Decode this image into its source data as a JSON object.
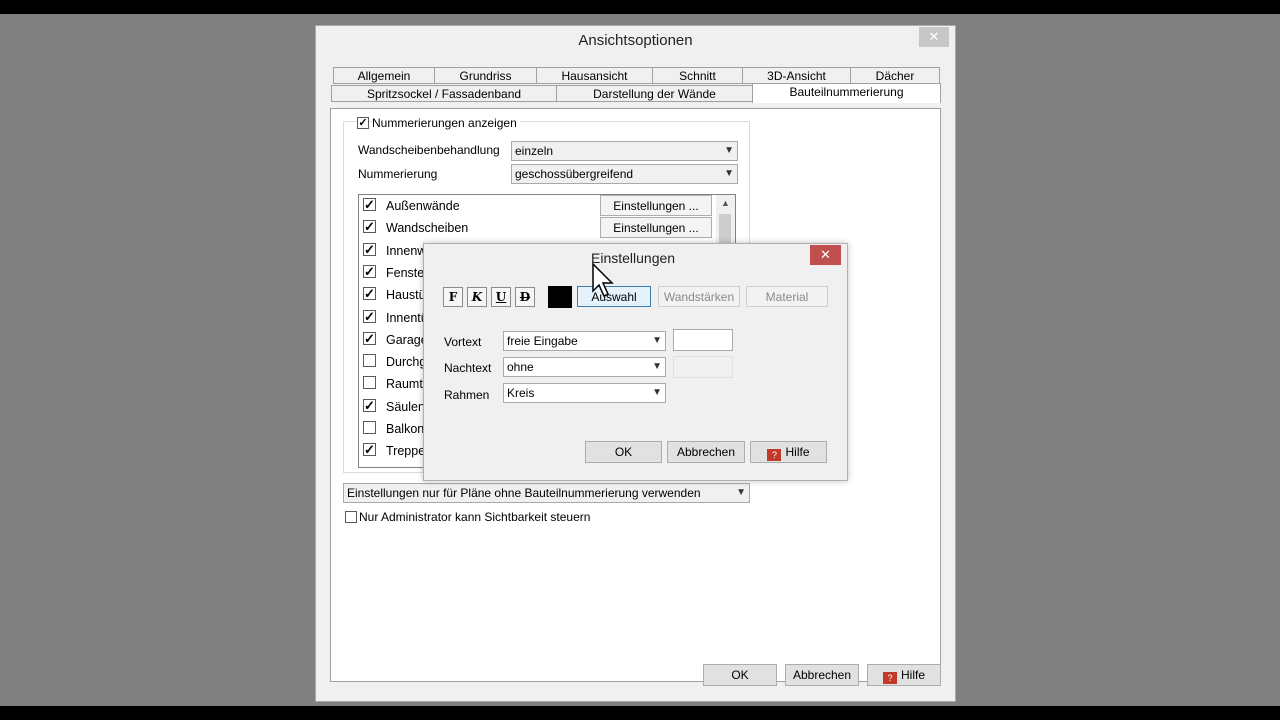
{
  "main_window": {
    "title": "Ansichtsoptionen",
    "close_glyph": "✕",
    "tabs_row1": [
      "Allgemein",
      "Grundriss",
      "Hausansicht",
      "Schnitt",
      "3D-Ansicht",
      "Dächer"
    ],
    "tabs_row2": [
      "Spritzsockel / Fassadenband",
      "Darstellung der Wände",
      "Bauteilnummerierung"
    ],
    "show_numbering": {
      "label": "Nummerierungen anzeigen",
      "checked": true
    },
    "wall_handling": {
      "label": "Wandscheibenbehandlung",
      "value": "einzeln"
    },
    "numbering": {
      "label": "Nummerierung",
      "value": "geschossübergreifend"
    },
    "items": [
      {
        "label": "Außenwände",
        "checked": true,
        "button": "Einstellungen ..."
      },
      {
        "label": "Wandscheiben",
        "checked": true,
        "button": "Einstellungen ..."
      },
      {
        "label": "Innenw",
        "checked": true
      },
      {
        "label": "Fenster",
        "checked": true
      },
      {
        "label": "Haustü",
        "checked": true
      },
      {
        "label": "Innentü",
        "checked": true
      },
      {
        "label": "Garage",
        "checked": true
      },
      {
        "label": "Durchg",
        "checked": false
      },
      {
        "label": "Raumt",
        "checked": false
      },
      {
        "label": "Säulen",
        "checked": true
      },
      {
        "label": "Balkon",
        "checked": false
      },
      {
        "label": "Treppe",
        "checked": true
      }
    ],
    "plans_dropdown": "Einstellungen nur für Pläne ohne Bauteilnummerierung verwenden",
    "admin_only": {
      "label": "Nur Administrator kann Sichtbarkeit steuern",
      "checked": false
    },
    "buttons": {
      "ok": "OK",
      "cancel": "Abbrechen",
      "help": "Hilfe"
    },
    "help_icon_text": "?"
  },
  "settings_dialog": {
    "title": "Einstellungen",
    "close_glyph": "✕",
    "format_buttons": [
      "F",
      "K",
      "U",
      "D"
    ],
    "color": "#000000",
    "auswahl_label": "Auswahl",
    "wandstaerken_label": "Wandstärken",
    "material_label": "Material",
    "vortext": {
      "label": "Vortext",
      "value": "freie Eingabe"
    },
    "nachtext": {
      "label": "Nachtext",
      "value": "ohne"
    },
    "rahmen": {
      "label": "Rahmen",
      "value": "Kreis"
    },
    "buttons": {
      "ok": "OK",
      "cancel": "Abbrechen",
      "help": "Hilfe"
    },
    "help_icon_text": "?"
  }
}
